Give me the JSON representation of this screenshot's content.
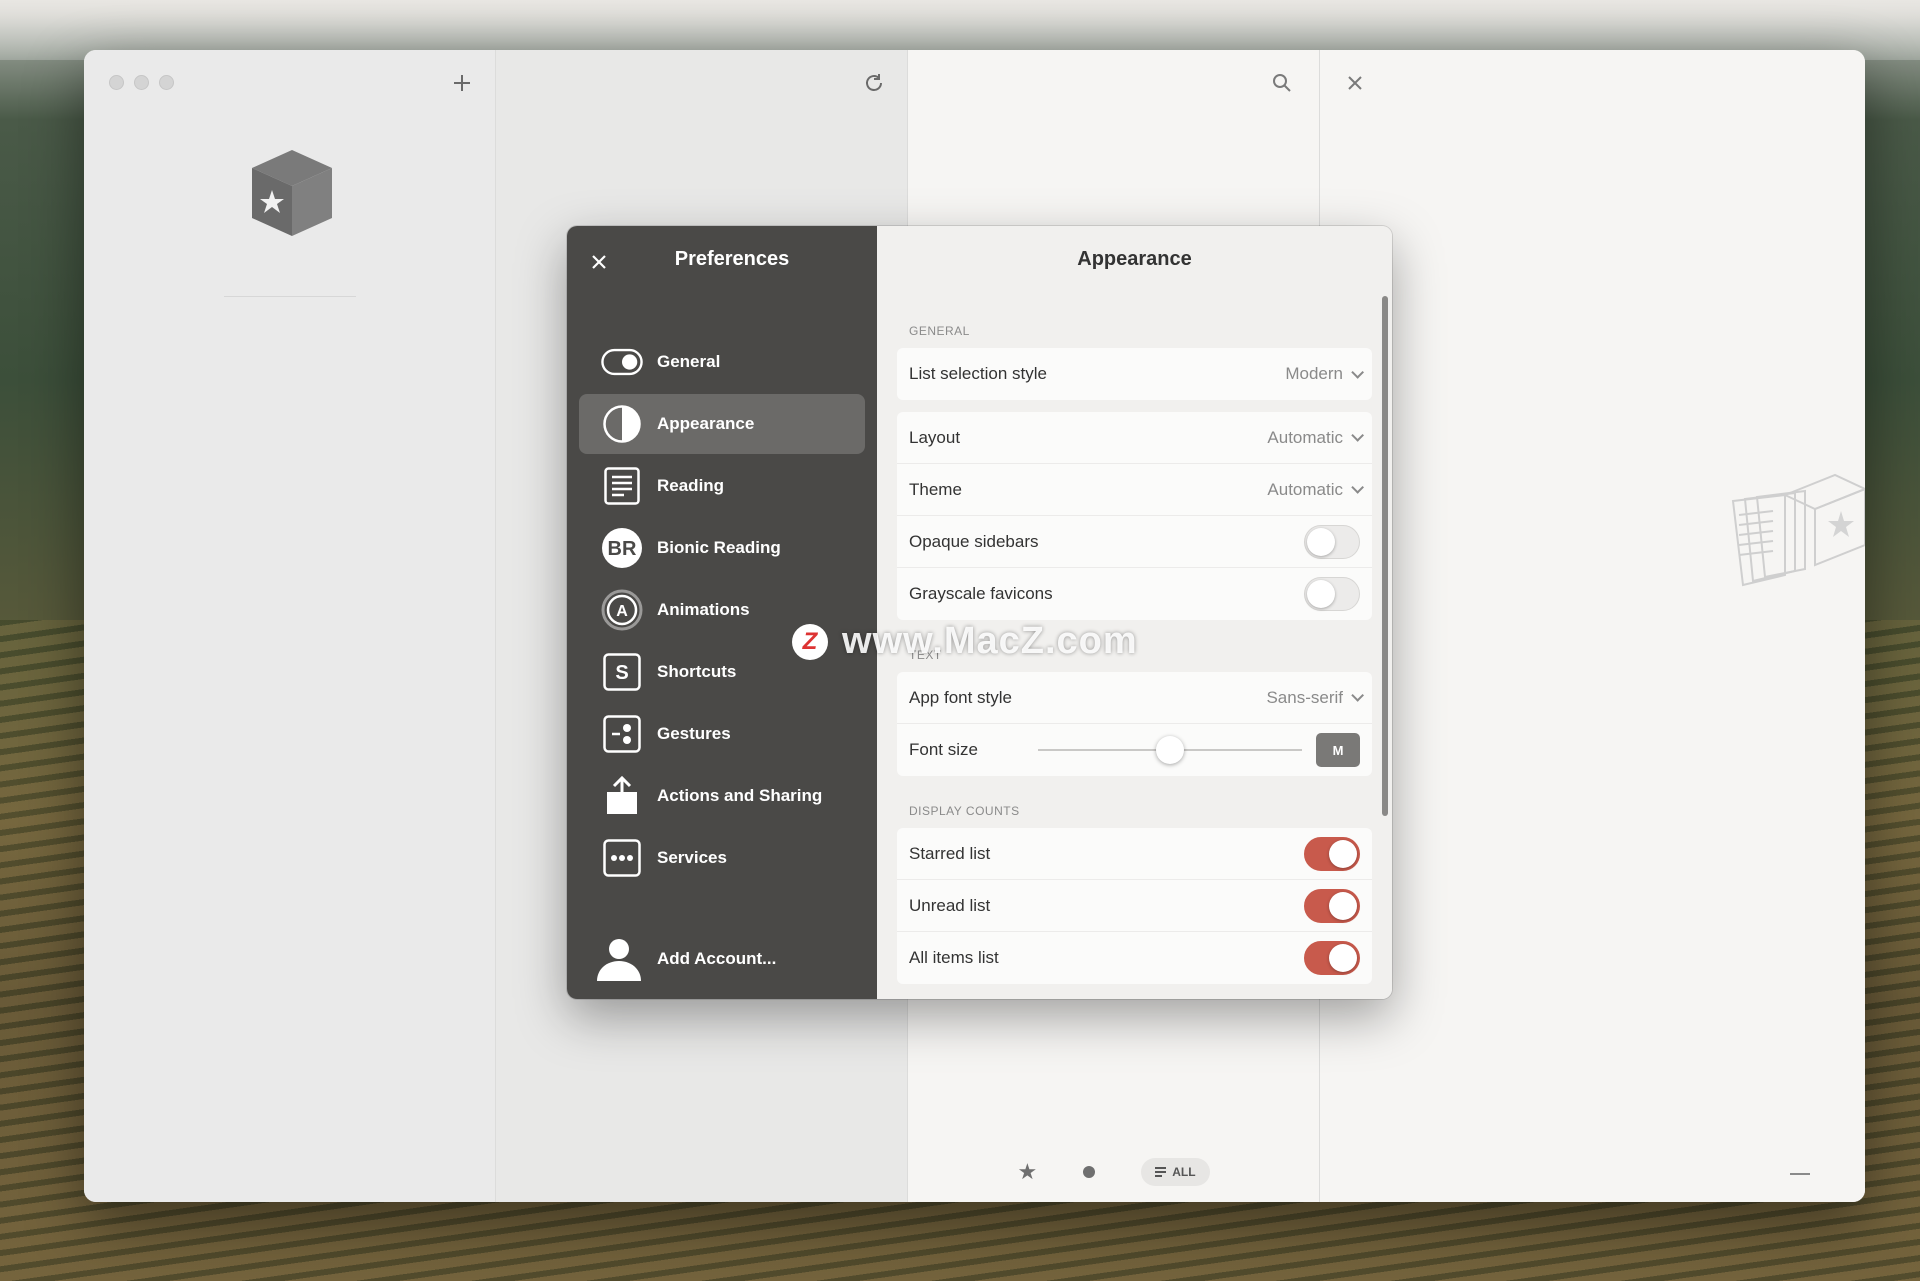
{
  "toolbar": {
    "add_icon": "plus-icon",
    "refresh_icon": "refresh-icon",
    "search_icon": "search-icon",
    "close_icon": "close-icon"
  },
  "bottom_bar": {
    "all_label": "ALL"
  },
  "preferences": {
    "title": "Preferences",
    "items": [
      {
        "label": "General",
        "icon": "toggle-icon"
      },
      {
        "label": "Appearance",
        "icon": "half-circle-icon",
        "active": true
      },
      {
        "label": "Reading",
        "icon": "document-icon"
      },
      {
        "label": "Bionic Reading",
        "icon": "br-icon"
      },
      {
        "label": "Animations",
        "icon": "animation-icon"
      },
      {
        "label": "Shortcuts",
        "icon": "shortcut-icon"
      },
      {
        "label": "Gestures",
        "icon": "gesture-icon"
      },
      {
        "label": "Actions and Sharing",
        "icon": "share-icon"
      },
      {
        "label": "Services",
        "icon": "services-icon"
      }
    ],
    "add_account": "Add Account..."
  },
  "appearance": {
    "title": "Appearance",
    "general_label": "GENERAL",
    "list_selection_style": {
      "label": "List selection style",
      "value": "Modern"
    },
    "layout": {
      "label": "Layout",
      "value": "Automatic"
    },
    "theme": {
      "label": "Theme",
      "value": "Automatic"
    },
    "opaque_sidebars": {
      "label": "Opaque sidebars",
      "on": false
    },
    "grayscale_favicons": {
      "label": "Grayscale favicons",
      "on": false
    },
    "text_label": "TEXT",
    "app_font_style": {
      "label": "App font style",
      "value": "Sans-serif"
    },
    "font_size": {
      "label": "Font size",
      "value": "M",
      "level": 0.5
    },
    "display_counts_label": "DISPLAY COUNTS",
    "starred_list": {
      "label": "Starred list",
      "on": true
    },
    "unread_list": {
      "label": "Unread list",
      "on": true
    },
    "all_items_list": {
      "label": "All items list",
      "on": true
    }
  },
  "colors": {
    "accent": "#c85a4c",
    "sidebar_bg": "#4a4947"
  },
  "watermark": {
    "logo": "Z",
    "text": "www.MacZ.com"
  }
}
